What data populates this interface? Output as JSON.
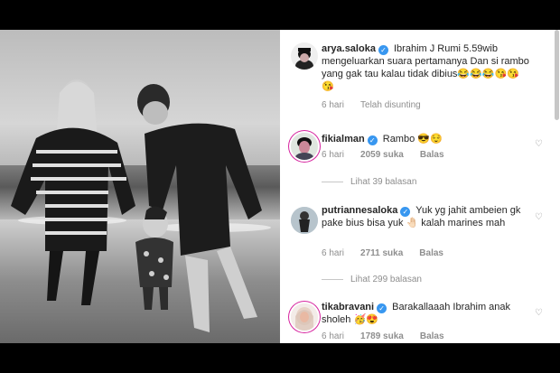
{
  "post": {
    "caption_user": "arya.saloka",
    "caption_text": "Ibrahim J Rumi 5.59wib mengeluarkan suara pertamanya Dan si rambo yang gak tau kalau tidak dibius😂😂😂😘😘😘",
    "caption_time": "6 hari",
    "caption_edited": "Telah disunting"
  },
  "comments": [
    {
      "user": "fikialman",
      "text": "Rambo 😎😌",
      "time": "6 hari",
      "likes": "2059 suka",
      "reply": "Balas",
      "view_replies": "Lihat 39 balasan"
    },
    {
      "user": "putriannesaloka",
      "text": "Yuk yg jahit ambeien gk pake bius bisa yuk 🤚🏻 kalah marines mah",
      "time": "6 hari",
      "likes": "2711 suka",
      "reply": "Balas",
      "view_replies": "Lihat 299 balasan"
    },
    {
      "user": "tikabravani",
      "text": "Barakallaaah Ibrahim anak sholeh 🥳😍",
      "time": "6 hari",
      "likes": "1789 suka",
      "reply": "Balas"
    }
  ],
  "icons": {
    "verified": "verified-badge-icon",
    "heart": "heart-outline-icon"
  },
  "colors": {
    "verified": "#3897f0",
    "text": "#262626",
    "muted": "#8e8e8e"
  }
}
